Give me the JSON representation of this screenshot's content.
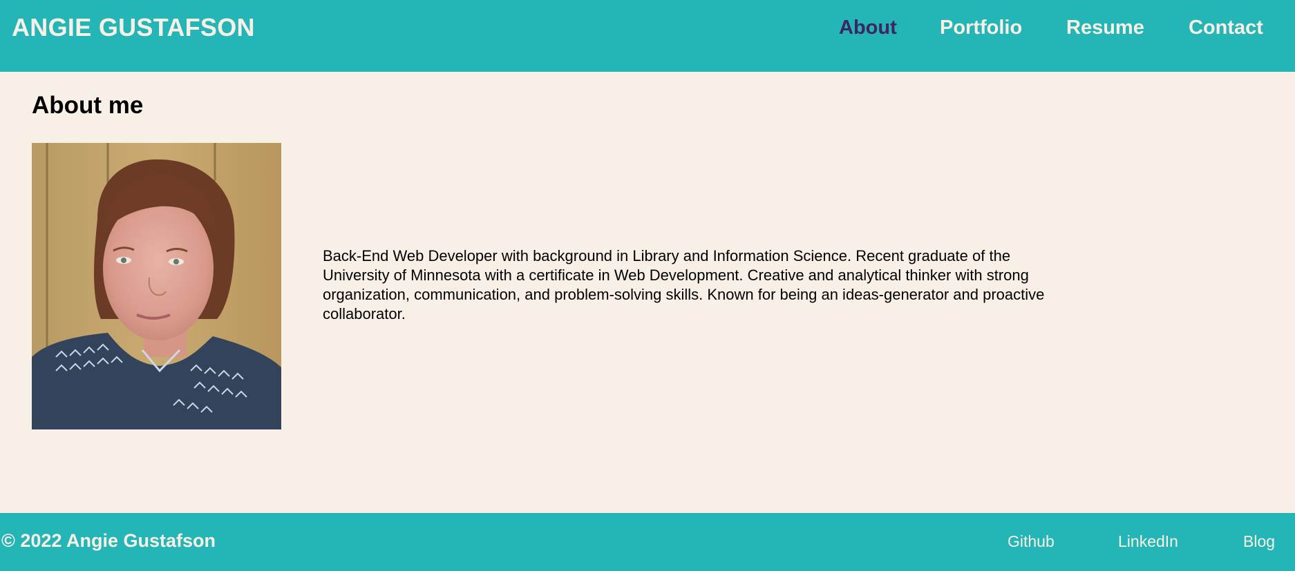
{
  "header": {
    "site_title": "ANGIE GUSTAFSON",
    "nav": [
      {
        "label": "About",
        "active": true
      },
      {
        "label": "Portfolio",
        "active": false
      },
      {
        "label": "Resume",
        "active": false
      },
      {
        "label": "Contact",
        "active": false
      }
    ]
  },
  "main": {
    "section_title": "About me",
    "bio": "Back-End Web Developer with background in Library and Information Science. Recent graduate of the University of Minnesota with a certificate in Web Development. Creative and analytical thinker with strong organization, communication, and problem-solving skills. Known for being an ideas-generator and proactive collaborator."
  },
  "footer": {
    "copyright": "© 2022 Angie Gustafson",
    "links": [
      {
        "label": "Github"
      },
      {
        "label": "LinkedIn"
      },
      {
        "label": "Blog"
      }
    ]
  },
  "colors": {
    "brand_teal": "#24b6b6",
    "background_cream": "#f8f0e6",
    "active_nav": "#3e2561"
  }
}
